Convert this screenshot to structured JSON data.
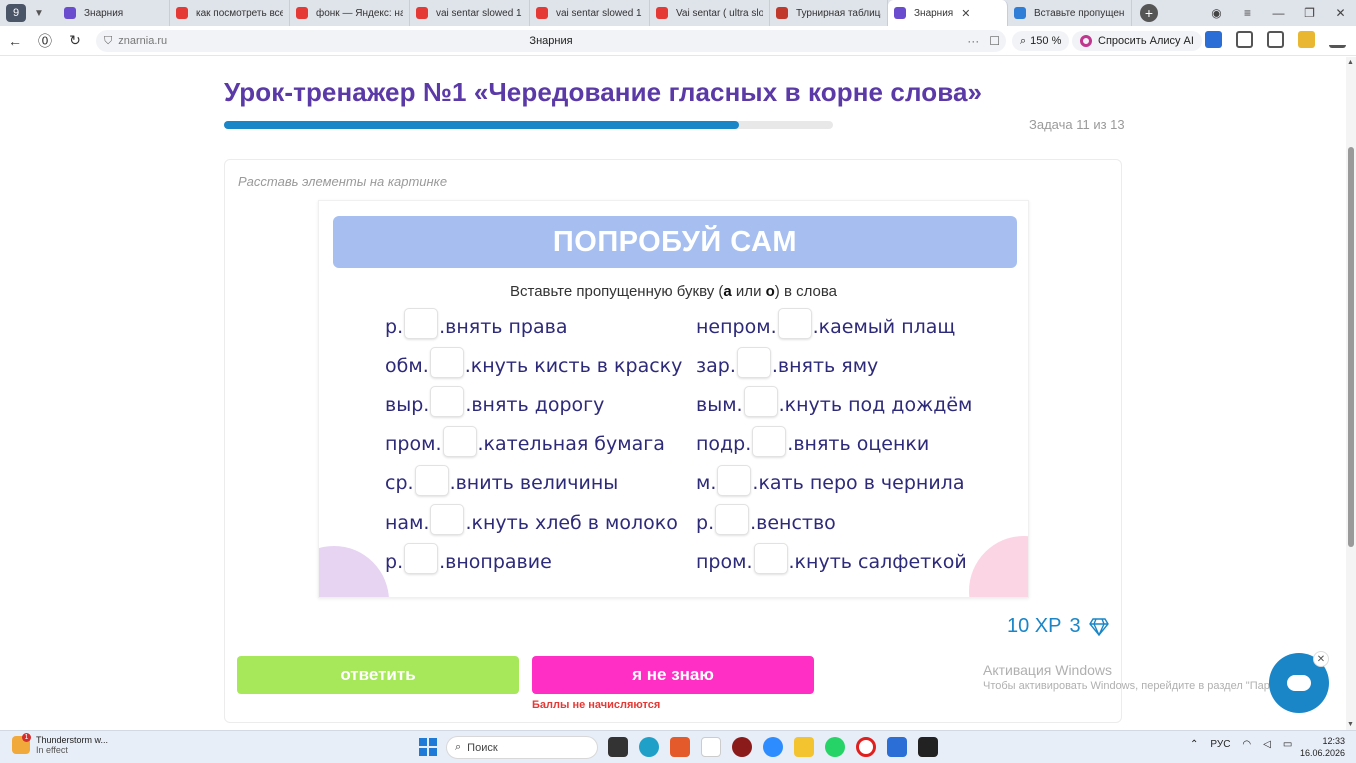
{
  "browser": {
    "tab_count": "9",
    "tabs": [
      {
        "label": "Знарния",
        "color": "#6a4ccf",
        "active": false
      },
      {
        "label": "как посмотреть все",
        "color": "#e53935",
        "active": false
      },
      {
        "label": "фонк — Яндекс: наш",
        "color": "#e53935",
        "active": false
      },
      {
        "label": "vai sentar slowed 1 ч",
        "color": "#e53935",
        "active": false
      },
      {
        "label": "vai sentar slowed 1 ч",
        "color": "#e53935",
        "active": false
      },
      {
        "label": "Vai sentar ( ultra slow",
        "color": "#e53935",
        "active": false
      },
      {
        "label": "Турнирная таблица",
        "color": "#c0392b",
        "active": false
      },
      {
        "label": "Знарния",
        "color": "#6a4ccf",
        "active": true
      },
      {
        "label": "Вставьте пропущенн",
        "color": "#2e7dd7",
        "active": false
      }
    ],
    "url": "znarnia.ru",
    "page_title": "Знарния",
    "zoom": "150 %",
    "alice_label": "Спросить Алису AI"
  },
  "lesson": {
    "title": "Урок-тренажер №1 «Чередование гласных в корне слова»",
    "progress": 0.846,
    "task_counter": "Задача 11 из 13",
    "hint": "Расставь элементы на картинке",
    "exercise": {
      "banner": "ПОПРОБУЙ САМ",
      "instruction_pre": "Вставьте пропущенную букву (",
      "instruction_a": "а",
      "instruction_mid": " или ",
      "instruction_o": "о",
      "instruction_post": ") в слова",
      "left_words": [
        {
          "pre": "р",
          "post": "внять права"
        },
        {
          "pre": "обм",
          "post": "кнуть кисть в краску"
        },
        {
          "pre": "выр",
          "post": "внять дорогу"
        },
        {
          "pre": "пром",
          "post": "кательная бумага"
        },
        {
          "pre": "ср",
          "post": "внить величины"
        },
        {
          "pre": "нам",
          "post": "кнуть хлеб в молоко"
        },
        {
          "pre": "р",
          "post": "вноправие"
        }
      ],
      "right_words": [
        {
          "pre": "непром",
          "post": "каемый плащ"
        },
        {
          "pre": "зар",
          "post": "внять яму"
        },
        {
          "pre": "вым",
          "post": "кнуть под дождём"
        },
        {
          "pre": "подр",
          "post": "внять оценки"
        },
        {
          "pre": "м",
          "post": "кать перо в чернила"
        },
        {
          "pre": "р",
          "post": "венство"
        },
        {
          "pre": "пром",
          "post": "кнуть салфеткой"
        }
      ]
    },
    "reward_xp": "10 ХР",
    "reward_gems": "3",
    "answer_button": "ответить",
    "dontknow_button": "я не знаю",
    "no_points": "Баллы не начисляются"
  },
  "windows_activation": {
    "line1": "Активация Windows",
    "line2": "Чтобы активировать Windows, перейдите в раздел \"Параметры\"."
  },
  "taskbar": {
    "weather_line1": "Thunderstorm w...",
    "weather_line2": "In effect",
    "weather_badge": "1",
    "search_placeholder": "Поиск",
    "lang": "РУС",
    "time": "12:33",
    "date": "16.06.2026"
  }
}
